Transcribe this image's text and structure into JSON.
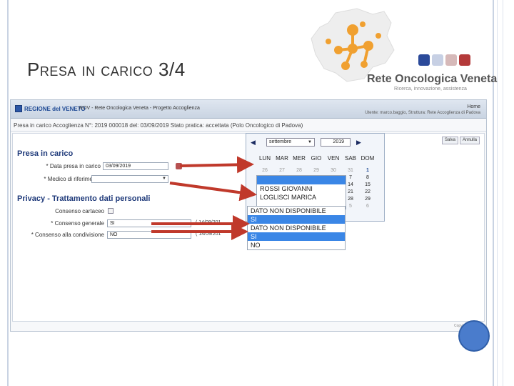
{
  "slide": {
    "title": "Presa in carico 3/4",
    "logo_text": "Rete Oncologica Veneta",
    "logo_sub": "Ricerca, innovazione, assistenza"
  },
  "app": {
    "region": "REGIONE del VENETO",
    "app_title": "ROV - Rete Oncologica Veneta - Progetto Accoglienza",
    "home_label": "Home",
    "user_info": "Utente: marco.baggio, Struttura: Rete Accoglienza di Padova",
    "status_bar": "Presa in carico   Accoglienza N°: 2019 000018 del: 03/09/2019   Stato pratica: accettata (Polo Oncologico di Padova)",
    "save_label": "Salva",
    "cancel_label": "Annulla",
    "copyright": "Copyright © 2019"
  },
  "form": {
    "section_presa": "Presa in carico",
    "data_label": "* Data presa in carico",
    "data_value": "03/09/2019",
    "medico_label": "* Medico di riferimento",
    "section_privacy": "Privacy - Trattamento dati personali",
    "consenso_cartaceo_label": "Consenso cartaceo",
    "consenso_generale_label": "* Consenso generale",
    "consenso_generale_value": "SI",
    "consenso_condivisione_label": "* Consenso alla condivisione",
    "consenso_condivisione_value": "NO",
    "side_date_1": "( 14/09/201",
    "side_date_2": "( 14/09/201"
  },
  "calendar": {
    "month": "settembre",
    "year": "2019",
    "weekdays": [
      "LUN",
      "MAR",
      "MER",
      "GIO",
      "VEN",
      "SAB",
      "DOM"
    ],
    "rows": [
      [
        "26",
        "27",
        "28",
        "29",
        "30",
        "31",
        "1"
      ],
      [
        "",
        "",
        "",
        "",
        "",
        "7",
        "8"
      ],
      [
        "",
        "",
        "",
        "",
        "",
        "14",
        "15"
      ],
      [
        "",
        "",
        "",
        "",
        "",
        "21",
        "22"
      ],
      [
        "",
        "",
        "",
        "",
        "",
        "28",
        "29"
      ],
      [
        "",
        "",
        "",
        "",
        "",
        "5",
        "6"
      ]
    ]
  },
  "medico_options": [
    "",
    "ROSSI GIOVANNI",
    "LOGLISCI MARICA"
  ],
  "consenso_options": [
    "DATO NON DISPONIBILE",
    "SI",
    "DATO NON DISPONIBILE",
    "SI",
    "NO"
  ],
  "colors": {
    "arrow": "#c0392b",
    "highlight": "#3a86e6",
    "logo_orange": "#f0a030"
  }
}
